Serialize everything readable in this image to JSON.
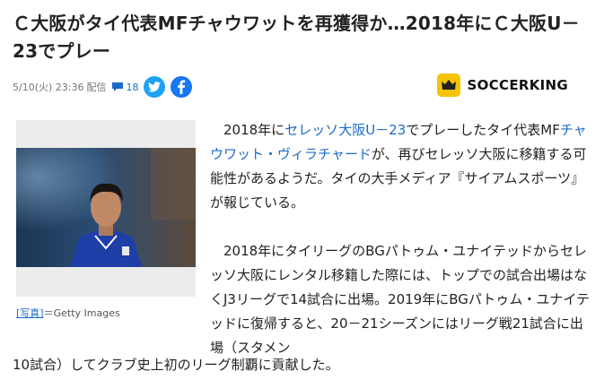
{
  "article": {
    "title": "Ｃ大阪がタイ代表MFチャウワットを再獲得か…2018年にＣ大阪U－23でプレー",
    "date": "5/10(火) 23:36",
    "kind": "配信",
    "comments": "18"
  },
  "brand": {
    "name": "SOCCERKING"
  },
  "figure": {
    "caption_link": "[写真]",
    "caption_text": "＝Getty Images"
  },
  "paragraph1": {
    "t1": "2018年に",
    "link1": "セレッソ大阪U－23",
    "t2": "でプレーしたタイ代表MF",
    "link2": "チャウワット・ヴィラチャード",
    "t3": "が、再びセレッソ大阪に移籍する可能性があるようだ。タイの大手メディア『サイアムスポーツ』が報じている。"
  },
  "paragraph2": {
    "a": "2018年にタイリーグのBGパトゥム・ユナイテッドからセレッソ大阪にレンタル移籍した際には、トップでの試合出場はなくJ3リーグで14試合に出場。2019年にBGパトゥム・ユナイテッドに復帰すると、20－21シーズンにはリーグ戦21試合に出場（スタメン",
    "b": "10試合）してクラブ史上初のリーグ制覇に貢献した。"
  },
  "colors": {
    "link": "#1a6bc9",
    "twitter": "#1da1f2",
    "facebook": "#1877f2",
    "brand": "#f5c400"
  },
  "icons": [
    "comment-icon",
    "twitter-icon",
    "facebook-icon",
    "soccerking-logo-icon"
  ]
}
